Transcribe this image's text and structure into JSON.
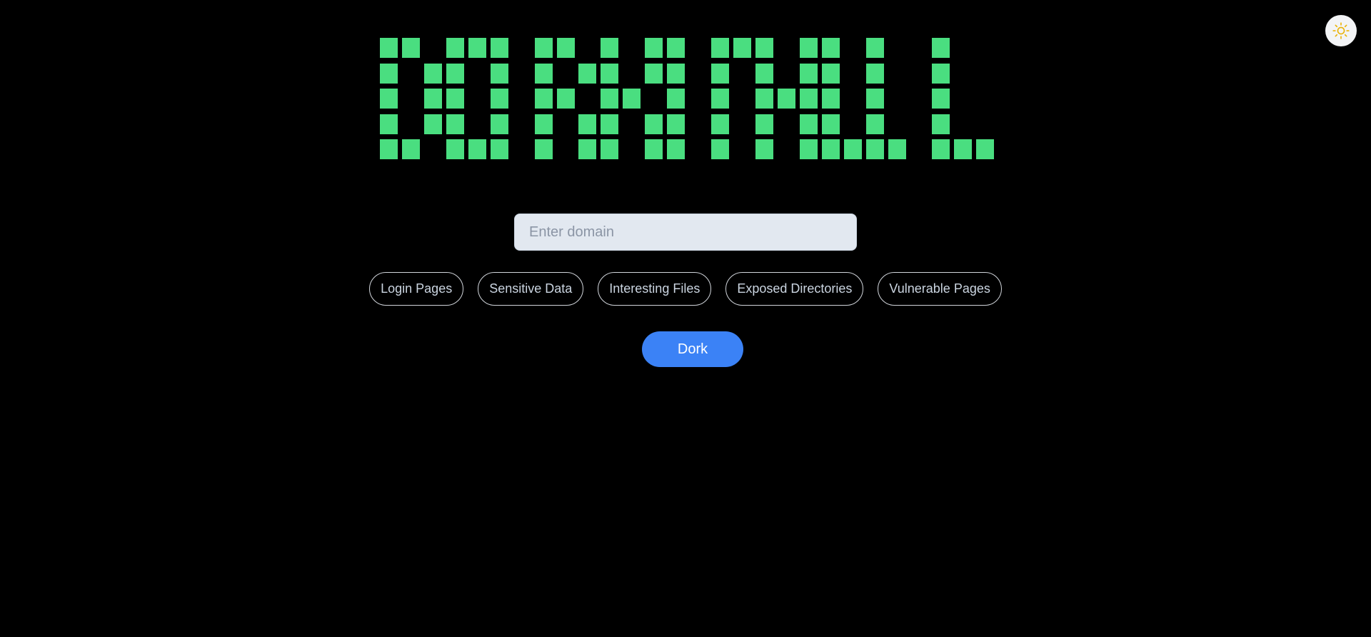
{
  "logo": {
    "text": "DORKTALL",
    "color": "#4ade80"
  },
  "theme_toggle": {
    "icon": "sun-icon",
    "icon_color": "#eab308"
  },
  "search": {
    "placeholder": "Enter domain",
    "value": ""
  },
  "filters": [
    {
      "label": "Login Pages"
    },
    {
      "label": "Sensitive Data"
    },
    {
      "label": "Interesting Files"
    },
    {
      "label": "Exposed Directories"
    },
    {
      "label": "Vulnerable Pages"
    }
  ],
  "actions": {
    "dork_label": "Dork",
    "dork_color": "#3b82f6"
  },
  "colors": {
    "background": "#000000"
  }
}
